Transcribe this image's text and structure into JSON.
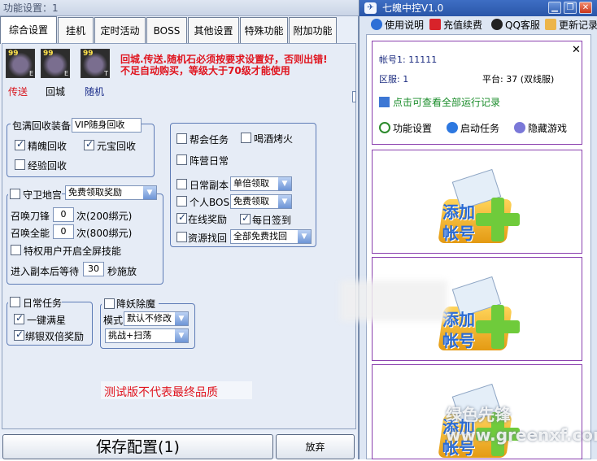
{
  "left_window": {
    "title": "功能设置：1",
    "tabs": [
      {
        "label": "综合设置",
        "active": true
      },
      {
        "label": "挂机"
      },
      {
        "label": "定时活动"
      },
      {
        "label": "BOSS"
      },
      {
        "label": "其他设置"
      },
      {
        "label": "特殊功能"
      },
      {
        "label": "附加功能"
      }
    ],
    "items": [
      {
        "level": "99",
        "letter": "E",
        "label": "传送",
        "label_color": "#d8141c"
      },
      {
        "level": "99",
        "letter": "E",
        "label": "回城",
        "label_color": "#000000"
      },
      {
        "level": "99",
        "letter": "T",
        "label": "随机",
        "label_color": "#1c2e8a"
      }
    ],
    "warning": {
      "line1": "回城.传送.随机石必须按要求设置好，否则出错!",
      "line2": "不足自动购买，等级大于70级才能使用"
    },
    "recycle": {
      "title": "包满回收装备",
      "mode": "VIP随身回收",
      "options": [
        {
          "label": "精魄回收",
          "checked": true
        },
        {
          "label": "元宝回收",
          "checked": true
        },
        {
          "label": "经验回收",
          "checked": false
        }
      ]
    },
    "daily": {
      "options": [
        {
          "label": "帮会任务",
          "checked": false
        },
        {
          "label": "喝酒烤火",
          "checked": false
        },
        {
          "label": "阵营日常",
          "checked": false
        }
      ],
      "dungeon_label": "日常副本",
      "dungeon_value": "单倍领取",
      "boss_label": "个人BOSS",
      "boss_value": "免费领取",
      "online_label": "在线奖励",
      "signin_label": "每日签到",
      "resource_label": "资源找回",
      "resource_value": "全部免费找回"
    },
    "guard": {
      "title": "守卫地宫",
      "reward": "免费领取奖励",
      "summon_blade_label": "召唤刀锋",
      "summon_blade_count": "0",
      "summon_blade_unit": "次(200绑元)",
      "summon_all_label": "召唤全能",
      "summon_all_count": "0",
      "summon_all_unit": "次(800绑元)",
      "privilege_label": "特权用户开启全屏技能",
      "wait_label": "进入副本后等待",
      "wait_value": "30",
      "wait_unit": "秒施放"
    },
    "daily_task": {
      "title": "日常任务",
      "options": [
        {
          "label": "一键满星",
          "checked": true
        },
        {
          "label": "绑银双倍奖励",
          "checked": true
        }
      ]
    },
    "demon": {
      "title": "降妖除魔",
      "mode_label": "模式",
      "mode_value": "默认不修改",
      "action_value": "挑战+扫荡"
    },
    "notice": "测试版不代表最终品质",
    "save_button": "保存配置(1)",
    "abandon_button": "放弃"
  },
  "right_window": {
    "title": "七魄中控V1.0",
    "menu": [
      {
        "label": "使用说明",
        "icon": "help-icon"
      },
      {
        "label": "充值续费",
        "icon": "recharge-icon"
      },
      {
        "label": "QQ客服",
        "icon": "qq-icon"
      },
      {
        "label": "更新记录",
        "icon": "update-icon"
      }
    ],
    "account_label": "帐号1:",
    "account_value": "11111",
    "server_label": "区服:",
    "server_value": "1",
    "platform_label": "平台:",
    "platform_value": "37 (双线服)",
    "log_link": "点击可查看全部运行记录",
    "buttons": [
      {
        "label": "功能设置",
        "icon": "gear-icon"
      },
      {
        "label": "启动任务",
        "icon": "play-icon"
      },
      {
        "label": "隐藏游戏",
        "icon": "hide-icon"
      }
    ],
    "add_slots": [
      {
        "line1": "添加",
        "line2": "帐号"
      },
      {
        "line1": "添加",
        "line2": "帐号"
      },
      {
        "line1": "添加",
        "line2": "帐号"
      }
    ]
  },
  "watermark": "绿色先锋 www.greenxf.com"
}
